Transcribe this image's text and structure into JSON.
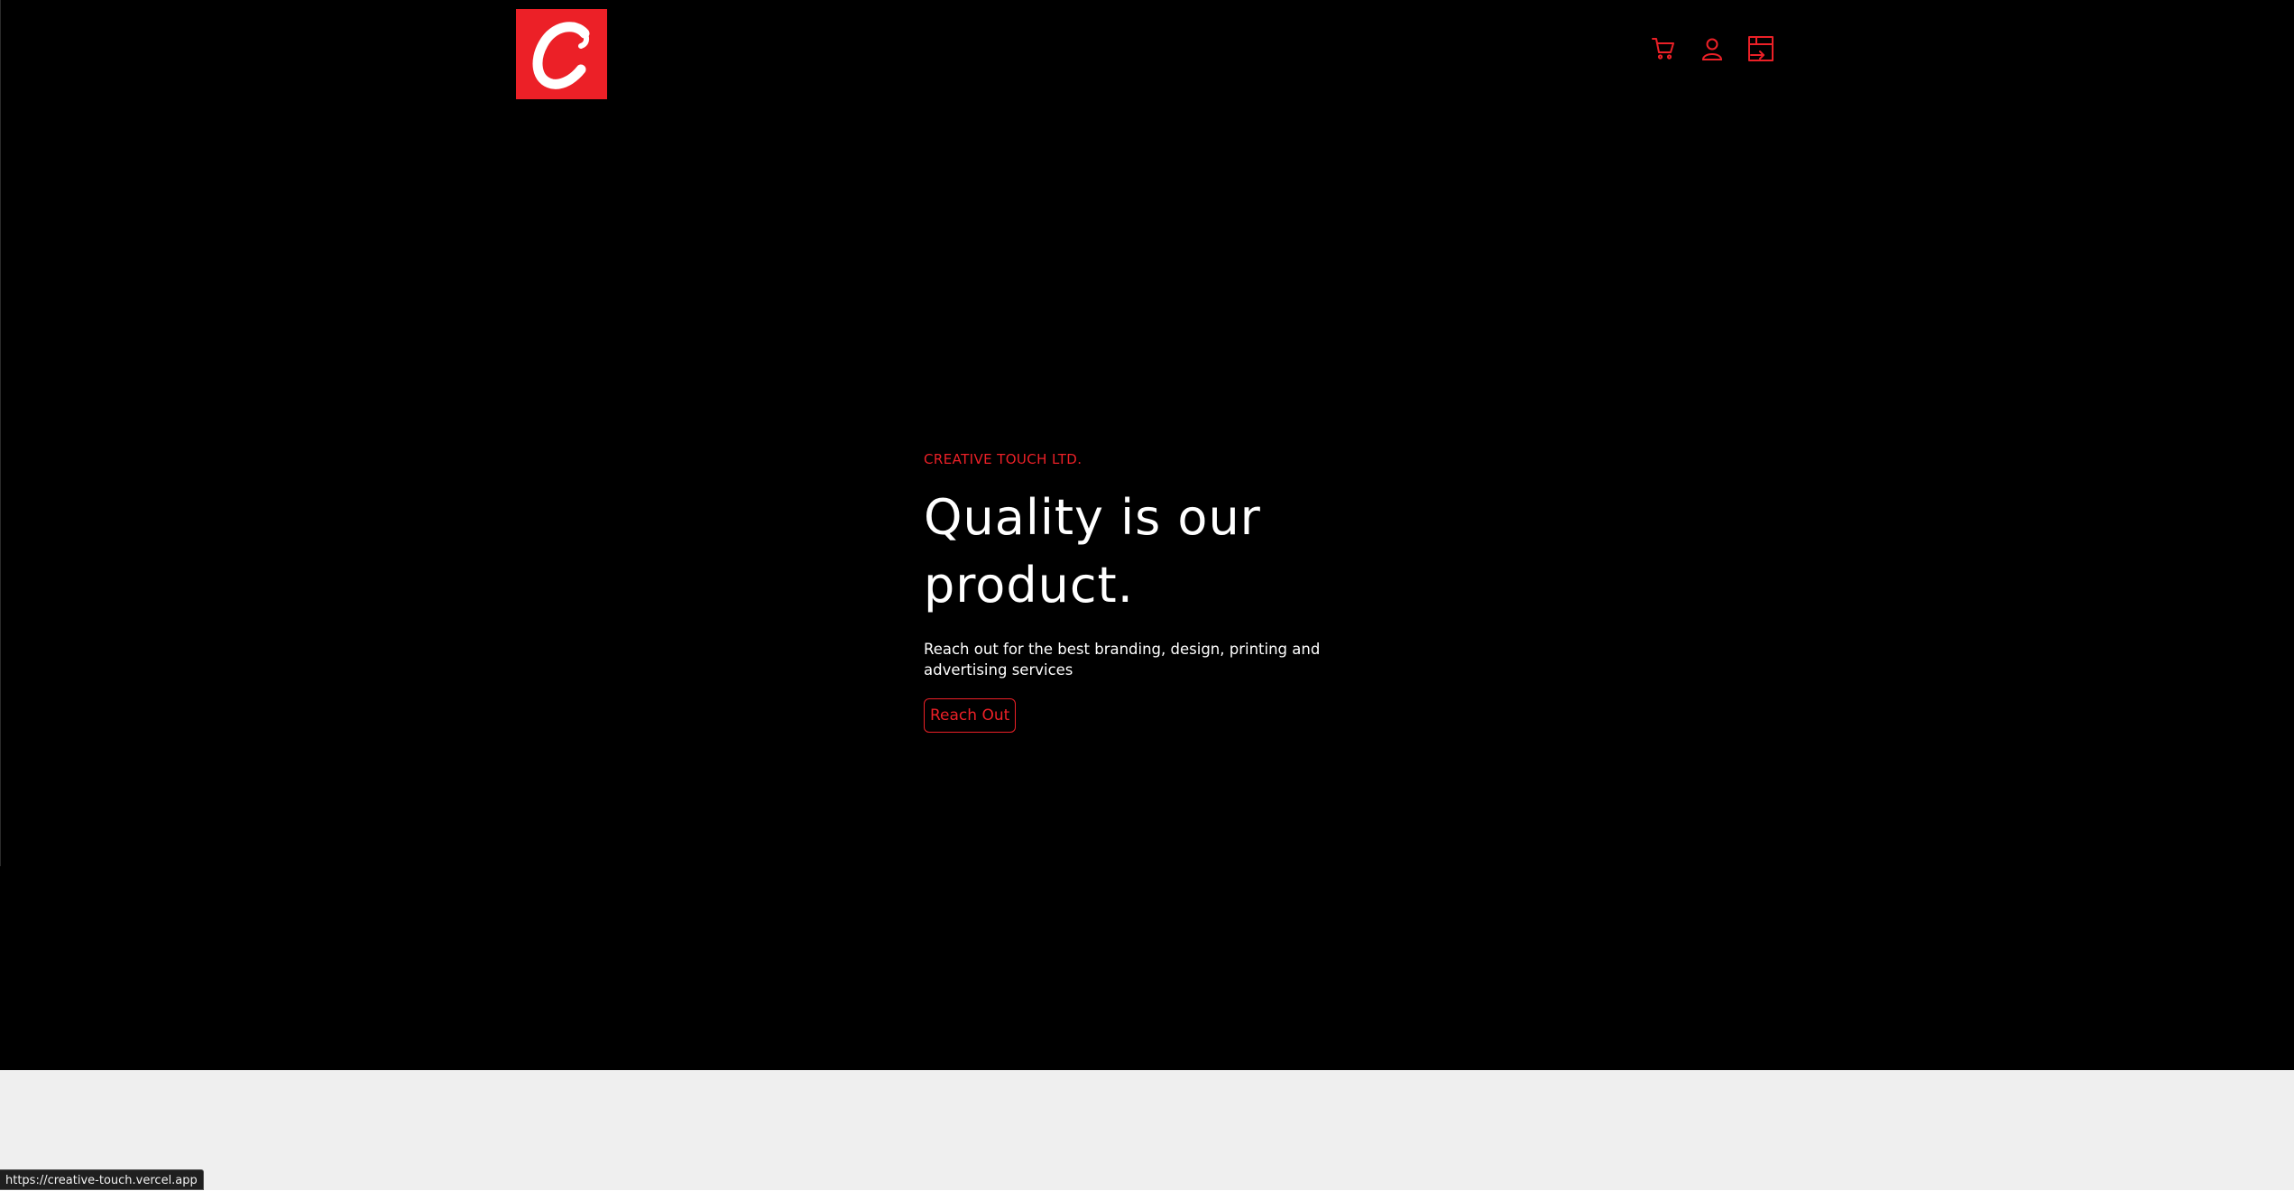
{
  "brand": {
    "logo_letter": "C",
    "accent_color": "#ec2027"
  },
  "nav": {
    "icons": [
      "cart-icon",
      "user-icon",
      "login-icon"
    ]
  },
  "hero": {
    "eyebrow": "CREATIVE TOUCH LTD.",
    "headline_line1": "Quality is our",
    "headline_line2": "product.",
    "subtext": "Reach out for the best branding, design, printing and advertising services",
    "cta_label": "Reach Out"
  },
  "status_bar": {
    "url": "https://creative-touch.vercel.app"
  }
}
